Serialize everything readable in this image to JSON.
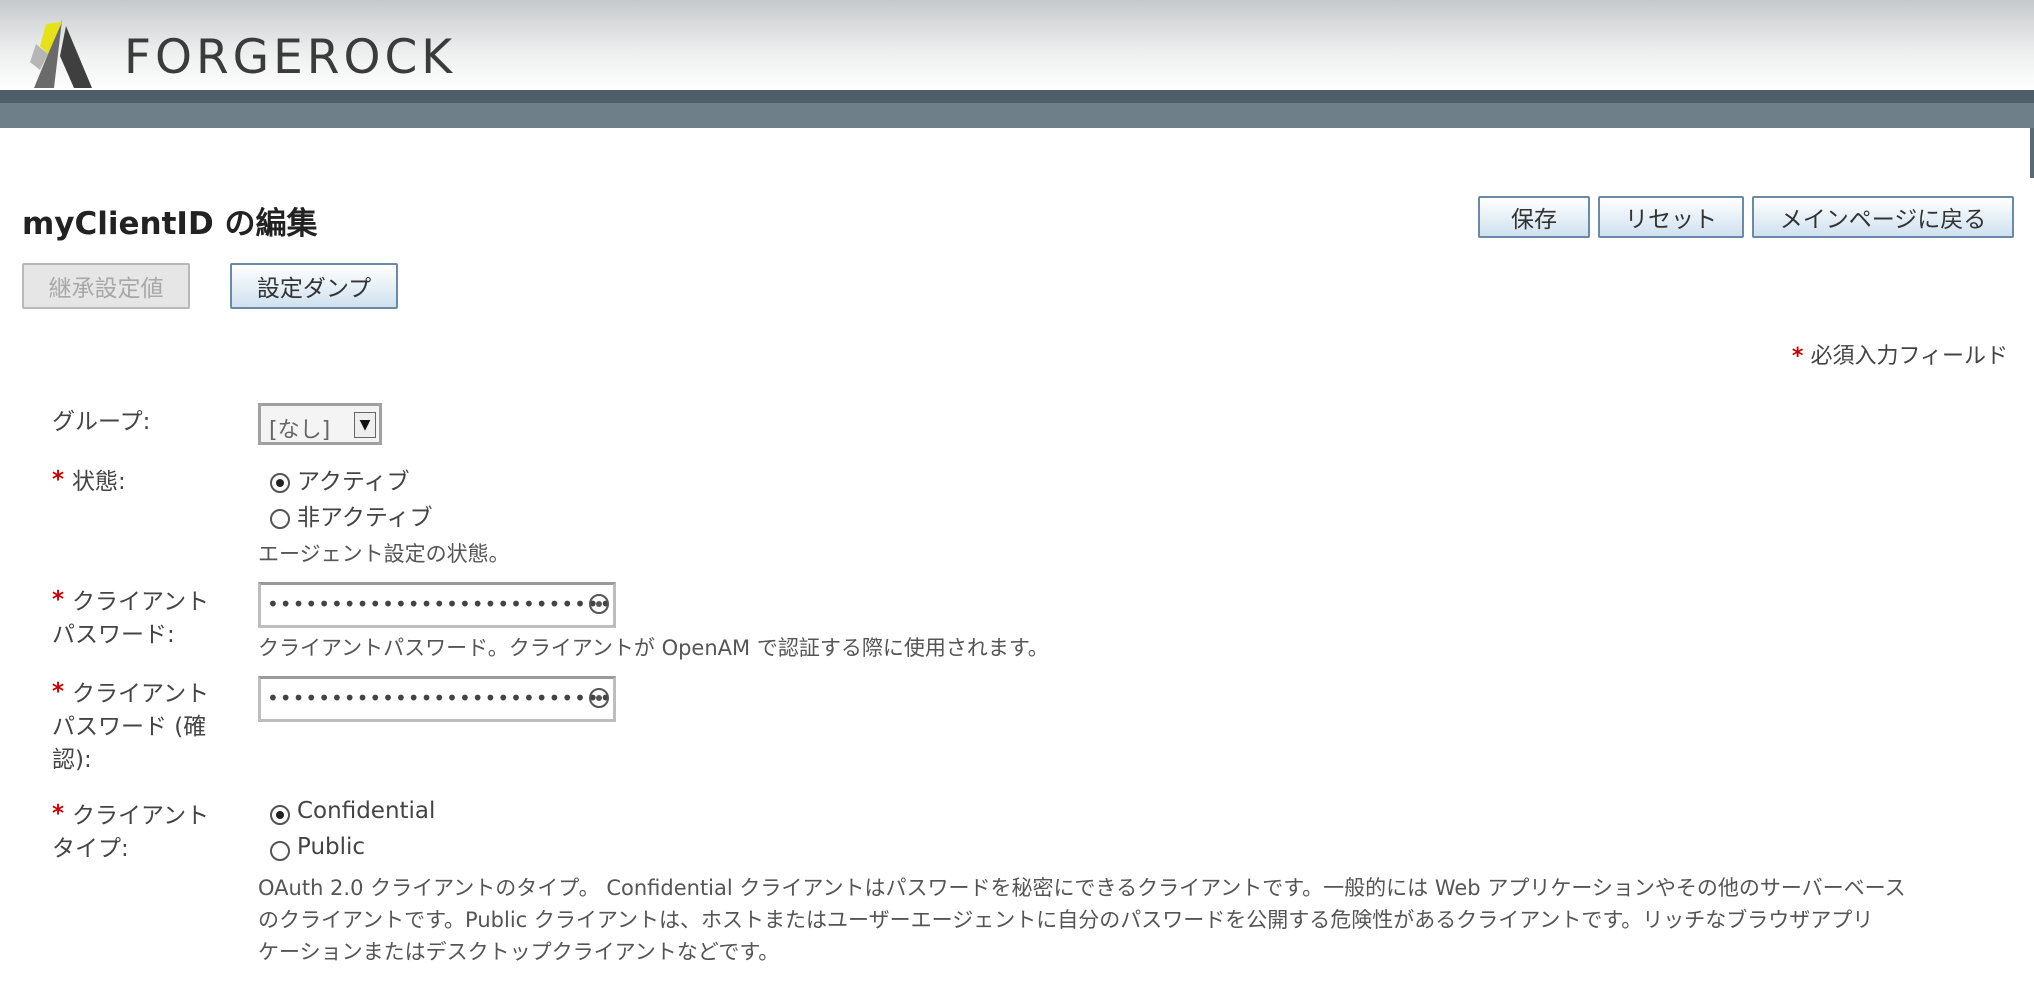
{
  "brand": {
    "logo_text": "FORGEROCK"
  },
  "page": {
    "title": "myClientID の編集",
    "buttons": {
      "save": "保存",
      "reset": "リセット",
      "back": "メインページに戻る",
      "inherit": "継承設定値",
      "dump": "設定ダンプ"
    },
    "required_note": "必須入力フィールド",
    "required_star": "*"
  },
  "form": {
    "group": {
      "label": "グループ:",
      "value": "[なし]"
    },
    "status": {
      "label": "状態:",
      "options": [
        "アクティブ",
        "非アクティブ"
      ],
      "selected": "アクティブ",
      "help": "エージェント設定の状態。"
    },
    "password": {
      "label_line1": "クライアント",
      "label_line2": "パスワード:",
      "masked_value": "••••••••••••••••••••••••••••",
      "help": "クライアントパスワード。クライアントが OpenAM で認証する際に使用されます。"
    },
    "password_confirm": {
      "label_line1": "クライアント",
      "label_line2": "パスワード (確",
      "label_line3": "認):",
      "masked_value": "••••••••••••••••••••••••••••"
    },
    "client_type": {
      "label_line1": "クライアント",
      "label_line2": "タイプ:",
      "options": [
        "Confidential",
        "Public"
      ],
      "selected": "Confidential",
      "help_line1": "OAuth 2.0 クライアントのタイプ。 Confidential クライアントはパスワードを秘密にできるクライアントです。一般的には Web アプリケーションやその他のサーバーベース",
      "help_line2": "のクライアントです。Public クライアントは、ホストまたはユーザーエージェントに自分のパスワードを公開する危険性があるクライアントです。リッチなブラウザアプリ",
      "help_line3": "ケーションまたはデスクトップクライアントなどです。"
    }
  },
  "icons": {
    "logo": "forgerock-logo-icon",
    "dropdown": "chevron-down-icon",
    "password_reveal": "eye-icon"
  },
  "colors": {
    "header_dark": "#4e5f6a",
    "header_mid": "#6e7f8a",
    "required": "#cc0000",
    "button_border": "#6b8aa6"
  }
}
